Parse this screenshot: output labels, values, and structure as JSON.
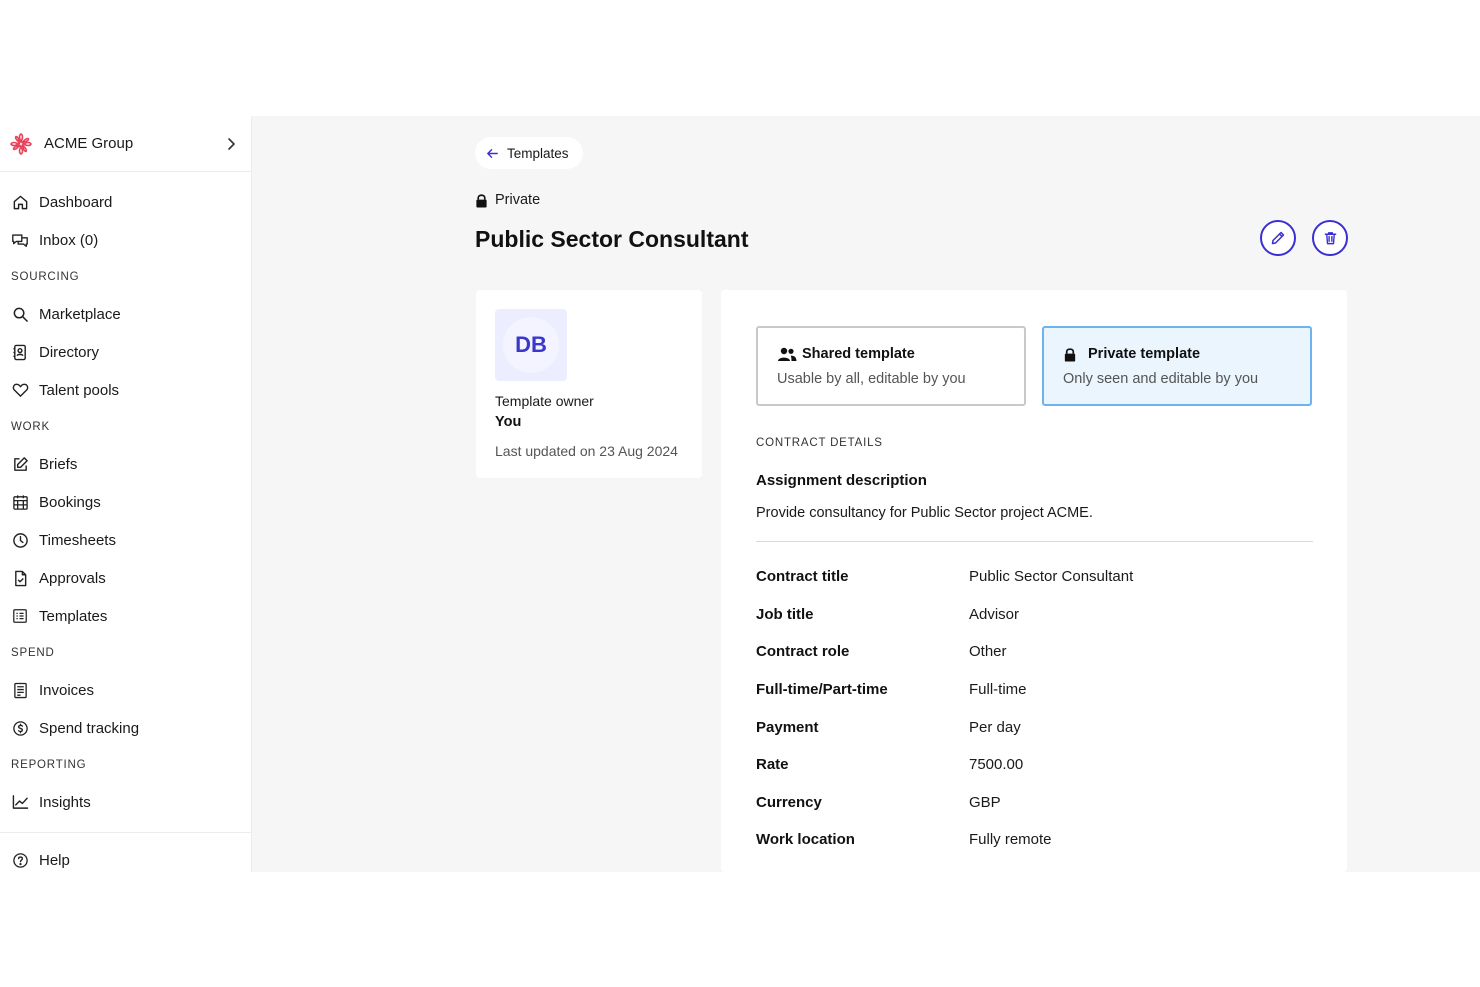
{
  "sidebar": {
    "org_name": "ACME Group",
    "items_top": [
      {
        "label": "Dashboard",
        "icon": "home-icon"
      },
      {
        "label": "Inbox (0)",
        "icon": "chat-icon"
      }
    ],
    "sourcing": {
      "label": "SOURCING",
      "items": [
        {
          "label": "Marketplace",
          "icon": "search-icon"
        },
        {
          "label": "Directory",
          "icon": "contact-book-icon"
        },
        {
          "label": "Talent pools",
          "icon": "heart-icon"
        }
      ]
    },
    "work": {
      "label": "WORK",
      "items": [
        {
          "label": "Briefs",
          "icon": "edit-icon"
        },
        {
          "label": "Bookings",
          "icon": "calendar-icon"
        },
        {
          "label": "Timesheets",
          "icon": "clock-icon"
        },
        {
          "label": "Approvals",
          "icon": "document-check-icon"
        },
        {
          "label": "Templates",
          "icon": "template-icon"
        }
      ]
    },
    "spend": {
      "label": "SPEND",
      "items": [
        {
          "label": "Invoices",
          "icon": "invoice-icon"
        },
        {
          "label": "Spend tracking",
          "icon": "dollar-circle-icon"
        }
      ]
    },
    "reporting": {
      "label": "REPORTING",
      "items": [
        {
          "label": "Insights",
          "icon": "line-chart-icon"
        }
      ]
    },
    "help": {
      "label": "Help",
      "icon": "help-circle-icon"
    }
  },
  "header": {
    "back_label": "Templates",
    "privacy": "Private",
    "title": "Public Sector Consultant"
  },
  "owner": {
    "initials": "DB",
    "label": "Template owner",
    "value": "You",
    "updated": "Last updated on 23 Aug 2024"
  },
  "template_options": {
    "shared": {
      "title": "Shared template",
      "desc": "Usable by all, editable by you"
    },
    "private": {
      "title": "Private template",
      "desc": "Only seen and editable by you"
    }
  },
  "contract": {
    "section_label": "CONTRACT DETAILS",
    "assignment_title": "Assignment description",
    "assignment_text": "Provide consultancy for Public Sector project ACME.",
    "rows": [
      {
        "key": "Contract title",
        "value": "Public Sector Consultant"
      },
      {
        "key": "Job title",
        "value": "Advisor"
      },
      {
        "key": "Contract role",
        "value": "Other"
      },
      {
        "key": "Full-time/Part-time",
        "value": "Full-time"
      },
      {
        "key": "Payment",
        "value": "Per day"
      },
      {
        "key": "Rate",
        "value": "7500.00"
      },
      {
        "key": "Currency",
        "value": "GBP"
      },
      {
        "key": "Work location",
        "value": "Fully remote"
      }
    ]
  },
  "colors": {
    "accent": "#3b2fd1",
    "brand_logo": "#e6435a",
    "selected_border": "#6cb3f0",
    "selected_bg": "#eaf5fd",
    "page_bg": "#f6f6f6"
  }
}
